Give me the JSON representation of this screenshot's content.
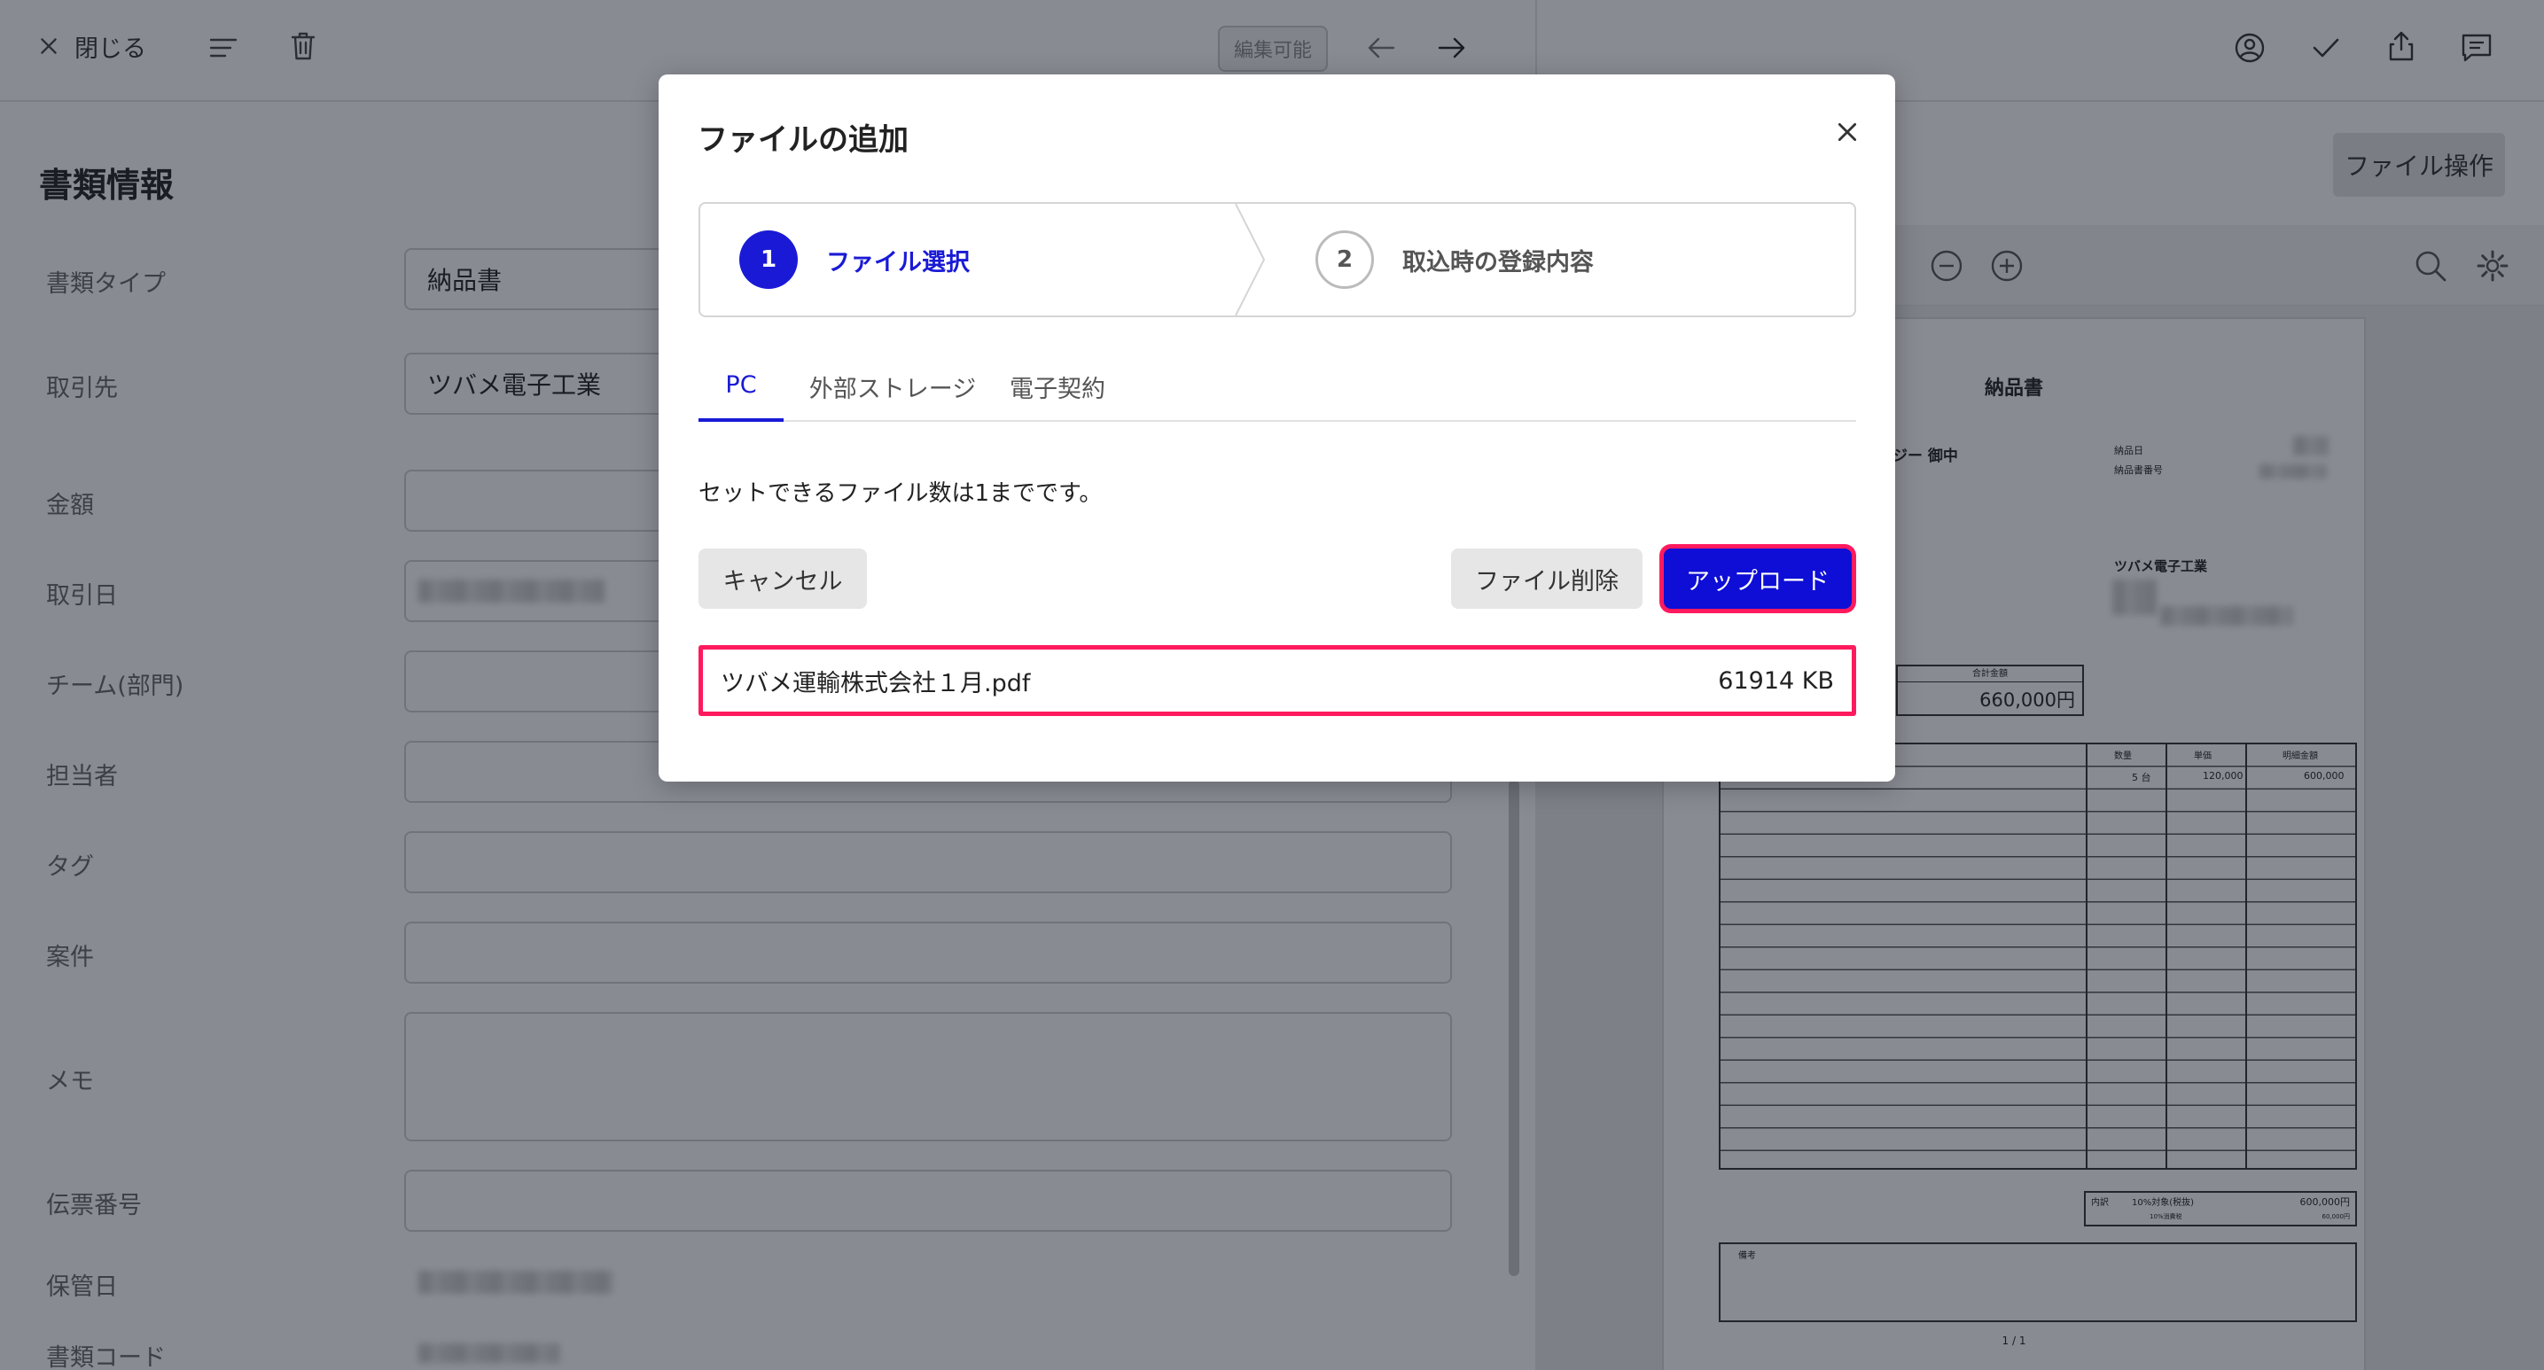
{
  "topbar": {
    "close_label": "閉じる",
    "edit_badge": "編集可能"
  },
  "form": {
    "title": "書類情報",
    "fields": [
      {
        "label": "書類タイプ",
        "value": "納品書"
      },
      {
        "label": "取引先",
        "value": "ツバメ電子工業"
      },
      {
        "label": "金額",
        "value": ""
      },
      {
        "label": "取引日",
        "value": ""
      },
      {
        "label": "チーム(部門)",
        "value": ""
      },
      {
        "label": "担当者",
        "value": ""
      },
      {
        "label": "タグ",
        "value": ""
      },
      {
        "label": "案件",
        "value": ""
      },
      {
        "label": "メモ",
        "value": ""
      },
      {
        "label": "伝票番号",
        "value": ""
      },
      {
        "label": "保管日",
        "value": ""
      },
      {
        "label": "書類コード",
        "value": ""
      }
    ]
  },
  "viewer": {
    "file_ops_label": "ファイル操作",
    "doc": {
      "title": "納品書",
      "recipient": "ジー 御中",
      "meta_labels": [
        "納品日",
        "納品書番号"
      ],
      "company": "ツバメ電子工業",
      "total_label": "合計金額",
      "total_value": "660,000円",
      "col_headers": [
        "摘要",
        "数量",
        "単価",
        "明細金額"
      ],
      "first_row": [
        "",
        "5 台",
        "120,000",
        "600,000"
      ],
      "summary_label": "内訳",
      "summary_tax_label": "10%対象(税抜)",
      "summary_tax_sub": "10%消費税",
      "summary_value": "600,000円",
      "summary_tax_value": "60,000円",
      "notes_label": "備考",
      "page": "1 / 1"
    }
  },
  "modal": {
    "title": "ファイルの追加",
    "steps": [
      {
        "num": "1",
        "label": "ファイル選択"
      },
      {
        "num": "2",
        "label": "取込時の登録内容"
      }
    ],
    "tabs": [
      "PC",
      "外部ストレージ",
      "電子契約"
    ],
    "info": "セットできるファイル数は1までです。",
    "cancel_label": "キャンセル",
    "delete_label": "ファイル削除",
    "upload_label": "アップロード",
    "file": {
      "name": "ツバメ運輸株式会社１月.pdf",
      "size": "61914 KB"
    }
  },
  "colors": {
    "accent": "#1a1ad6",
    "highlight": "#ff1a5e"
  }
}
